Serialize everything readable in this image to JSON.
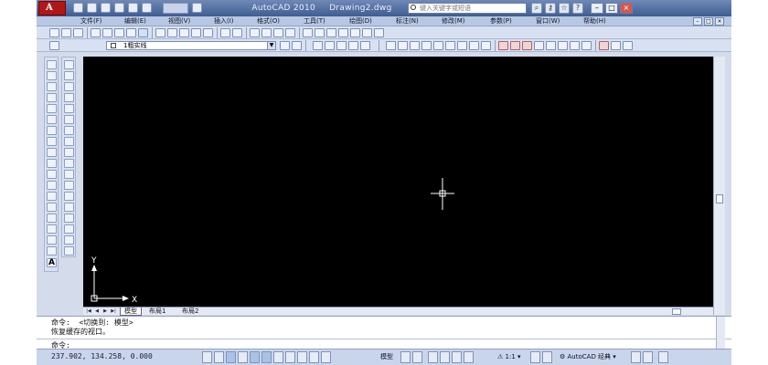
{
  "window": {
    "app_title": "AutoCAD 2010",
    "document": "Drawing2.dwg",
    "workspace_box": "",
    "search_placeholder": "键入关键字或短语"
  },
  "menu": {
    "items": [
      "文件(F)",
      "编辑(E)",
      "视图(V)",
      "插入(I)",
      "格式(O)",
      "工具(T)",
      "绘图(D)",
      "标注(N)",
      "修改(M)",
      "参数(P)",
      "窗口(W)",
      "帮助(H)"
    ]
  },
  "layer_toolbar": {
    "current_layer": "1粗实线"
  },
  "canvas": {
    "background": "#000000",
    "crosshair_color": "#ffffff",
    "ucs_y_label": "Y",
    "ucs_x_label": "X"
  },
  "layout_tabs": [
    "模型",
    "布局1",
    "布局2"
  ],
  "active_tab": "模型",
  "command_window": {
    "lines": [
      "命令:  <切换到: 模型>",
      "恢复缓存的视口。"
    ],
    "prompt": "命令:"
  },
  "status_bar": {
    "coordinates": "237.902, 134.258, 0.000",
    "model_label": "模型",
    "annotation_scale": "1:1",
    "workspace": "AutoCAD 经典"
  }
}
